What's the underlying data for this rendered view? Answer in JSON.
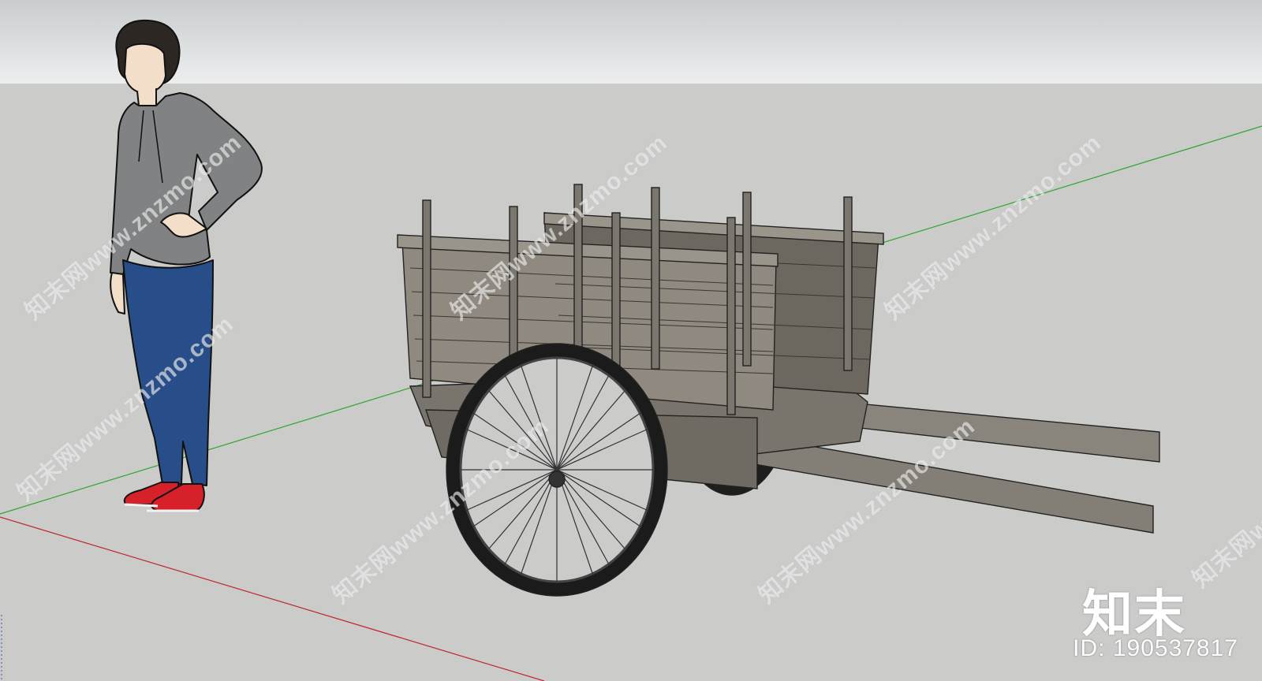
{
  "watermark": {
    "site": "知末网www.znzmo.com",
    "brand": "知末",
    "asset_id": "ID: 190537817"
  },
  "scene": {
    "objects": [
      "human-figure",
      "wicker-hand-cart"
    ],
    "axis_colors": {
      "green": "#2fa52f",
      "red": "#c0272d"
    },
    "cart_wood_color": "#7d786f",
    "tire_color": "#202020"
  }
}
